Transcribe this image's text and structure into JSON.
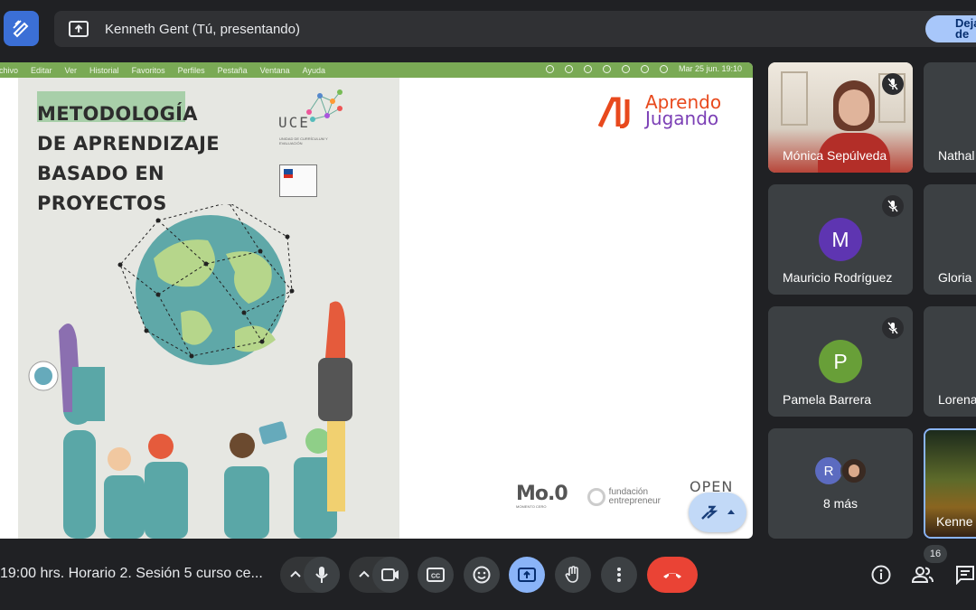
{
  "presenting_bar": {
    "title": "Kenneth Gent (Tú, presentando)",
    "stop_label": "Dejar de presentar"
  },
  "shared_screen": {
    "mac_menu": [
      "Archivo",
      "Editar",
      "Ver",
      "Historial",
      "Favoritos",
      "Perfiles",
      "Pestaña",
      "Ventana",
      "Ayuda"
    ],
    "mac_clock": "Mar 25 jun.  19:10",
    "slide_title_lines": [
      "METODOLOGÍA",
      "DE APRENDIZAJE",
      "BASADO EN",
      "PROYECTOS"
    ],
    "uce_logo": "UCE",
    "uce_subtitle": "UNIDAD DE CURRÍCULUM Y EVALUACIÓN",
    "brand_line1": "Aprendo",
    "brand_line2": "Jugando",
    "mo0_logo": "Mo.0",
    "mo0_sub": "MOMENTO CERO",
    "fundacion_line1": "fundación",
    "fundacion_line2": "entrepreneur",
    "open_logo": "OPEN"
  },
  "participants": [
    {
      "name": "Mónica Sepúlveda",
      "type": "video"
    },
    {
      "name": "Nathal",
      "type": "video"
    },
    {
      "name": "Mauricio Rodríguez",
      "initial": "M",
      "avatar_color": "#5e35b1",
      "muted": true
    },
    {
      "name": "Gloria",
      "type": "partial"
    },
    {
      "name": "Pamela Barrera",
      "initial": "P",
      "avatar_color": "#689f38",
      "muted": true
    },
    {
      "name": "Lorena",
      "type": "partial"
    },
    {
      "name": "8 más",
      "initial": "R",
      "avatar_color": "#5c6bc0"
    },
    {
      "name": "Kenne",
      "type": "video"
    }
  ],
  "bottom_bar": {
    "meeting_title": "19:00 hrs. Horario 2. Sesión 5 curso ce...",
    "participant_count": "16"
  },
  "colors": {
    "accent": "#a8c7fa",
    "end_call": "#ea4335",
    "present_active": "#8ab4f8",
    "mac_bar": "#7aaa55"
  }
}
